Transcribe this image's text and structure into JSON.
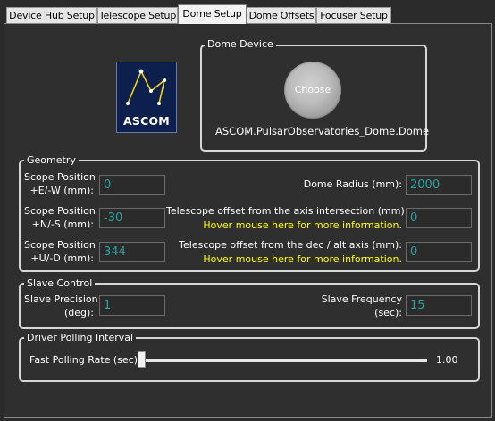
{
  "tabs": [
    {
      "label": "Device Hub Setup"
    },
    {
      "label": "Telescope Setup"
    },
    {
      "label": "Dome Setup"
    },
    {
      "label": "Dome Offsets"
    },
    {
      "label": "Focuser Setup"
    }
  ],
  "active_tab": "Dome Setup",
  "logo": {
    "text": "ASCOM"
  },
  "dome_device": {
    "title": "Dome Device",
    "choose_label": "Choose",
    "device_name": "ASCOM.PulsarObservatories_Dome.Dome"
  },
  "geometry": {
    "title": "Geometry",
    "scope_ew_label_1": "Scope Position",
    "scope_ew_label_2": "+E/-W (mm):",
    "scope_ew_value": "0",
    "scope_ns_label_1": "Scope Position",
    "scope_ns_label_2": "+N/-S (mm):",
    "scope_ns_value": "-30",
    "scope_ud_label_1": "Scope Position",
    "scope_ud_label_2": "+U/-D (mm):",
    "scope_ud_value": "344",
    "dome_radius_label": "Dome Radius (mm):",
    "dome_radius_value": "2000",
    "axis_offset_label": "Telescope offset from the axis intersection (mm):",
    "axis_offset_hint": "Hover mouse here for more information.",
    "axis_offset_value": "0",
    "dec_offset_label": "Telescope offset from the dec / alt axis (mm):",
    "dec_offset_hint": "Hover mouse here for more information.",
    "dec_offset_value": "0"
  },
  "slave_control": {
    "title": "Slave Control",
    "precision_label_1": "Slave Precision",
    "precision_label_2": "(deg):",
    "precision_value": "1",
    "frequency_label_1": "Slave Frequency",
    "frequency_label_2": "(sec):",
    "frequency_value": "15"
  },
  "polling": {
    "title": "Driver Polling Interval",
    "rate_label": "Fast Polling Rate (sec):",
    "rate_value": "1.00",
    "slider_fraction": 0.0
  },
  "colors": {
    "background": "#2b2b2b",
    "field_text": "#2aa3a3",
    "hint_text": "#ffff00",
    "logo_bg": "#0d1f4d"
  }
}
